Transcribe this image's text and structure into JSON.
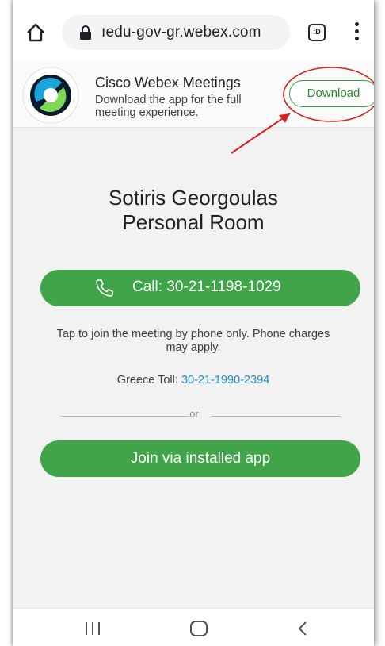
{
  "browser": {
    "url": "ıedu-gov-gr.webex.com",
    "tabs_count": ":D"
  },
  "banner": {
    "app_name": "Cisco Webex Meetings",
    "description": "Download the app for the full meeting experience.",
    "download_label": "Download"
  },
  "room": {
    "title_line1": "Sotiris Georgoulas",
    "title_line2": "Personal Room",
    "call_label": "Call: 30-21-1198-1029",
    "tap_info": "Tap to join the meeting by phone only. Phone charges may apply.",
    "toll_label": "Greece Toll: ",
    "toll_number": "30-21-1990-2394",
    "or_text": "or",
    "join_label": "Join via installed app"
  },
  "icons": {
    "home": "home-icon",
    "lock": "lock-icon",
    "tabs": "tabs-icon",
    "menu": "more-vert-icon",
    "logo": "webex-logo",
    "phone": "phone-icon",
    "nav_recents": "recents-icon",
    "nav_home": "nav-home-icon",
    "nav_back": "back-icon"
  },
  "colors": {
    "accent_green": "#3fa548",
    "link_blue": "#1f8fc7",
    "annotation_red": "#d62020"
  }
}
